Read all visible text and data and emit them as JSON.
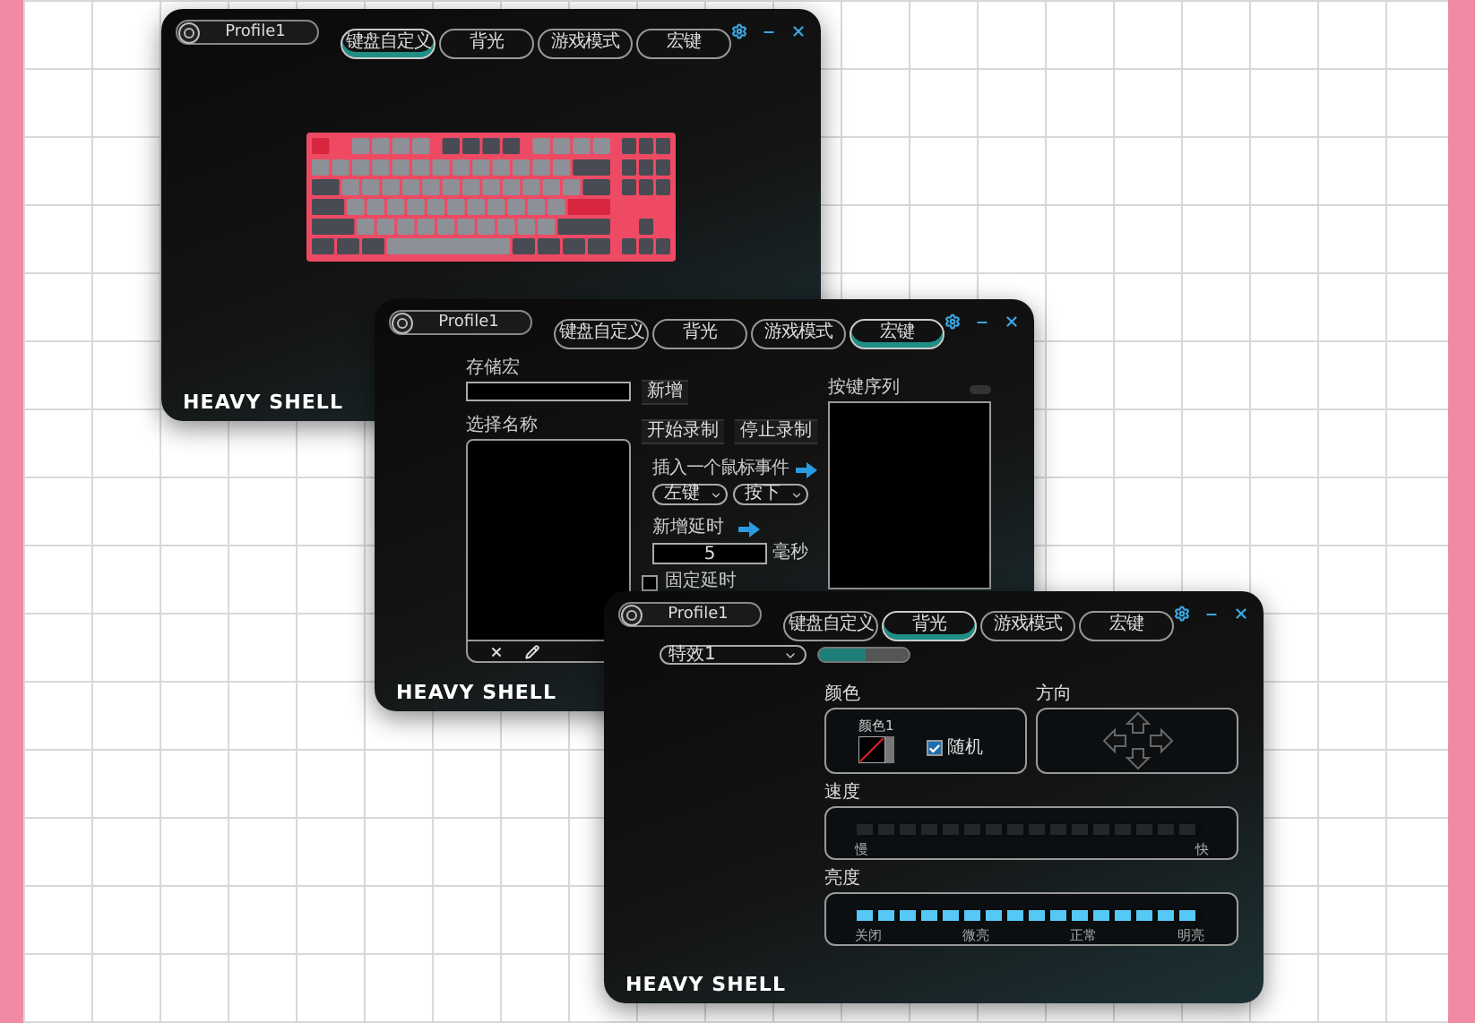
{
  "windows": [
    {
      "kind": "keyboard",
      "profile": "Profile1",
      "tabs": [
        {
          "label": "键盘自定义",
          "selected": true
        },
        {
          "label": "背光",
          "selected": false
        },
        {
          "label": "游戏模式",
          "selected": false
        },
        {
          "label": "宏键",
          "selected": false
        }
      ],
      "brand": "HEAVY SHELL"
    },
    {
      "kind": "macro",
      "profile": "Profile1",
      "tabs": [
        {
          "label": "键盘自定义",
          "selected": false
        },
        {
          "label": "背光",
          "selected": false
        },
        {
          "label": "游戏模式",
          "selected": false
        },
        {
          "label": "宏键",
          "selected": true
        }
      ],
      "brand": "HEAVY SHELL",
      "save_label": "存储宏",
      "add_button": "新增",
      "name_label": "选择名称",
      "record_buttons": [
        "开始录制",
        "停止录制"
      ],
      "sequence_label": "按键序列",
      "mouse_event_label": "插入一个鼠标事件",
      "mouse_selects": [
        "左键",
        "按下"
      ],
      "delay_label": "新增延时",
      "delay_value": "5",
      "delay_unit": "毫秒",
      "fixed_delay": {
        "label": "固定延时",
        "checked": false
      }
    },
    {
      "kind": "lighting",
      "profile": "Profile1",
      "tabs": [
        {
          "label": "键盘自定义",
          "selected": false
        },
        {
          "label": "背光",
          "selected": true
        },
        {
          "label": "游戏模式",
          "selected": false
        },
        {
          "label": "宏键",
          "selected": false
        }
      ],
      "brand": "HEAVY SHELL",
      "effect": "特效1",
      "toggle": {
        "on": true
      },
      "color_label": "颜色",
      "color_name": "颜色1",
      "random": {
        "label": "随机",
        "checked": true
      },
      "direction_label": "方向",
      "speed": {
        "label": "速度",
        "level": 0,
        "ticks": [
          "慢",
          "快"
        ]
      },
      "brightness": {
        "label": "亮度",
        "level": 1,
        "ticks": [
          "关闭",
          "微亮",
          "正常",
          "明亮"
        ]
      }
    }
  ]
}
